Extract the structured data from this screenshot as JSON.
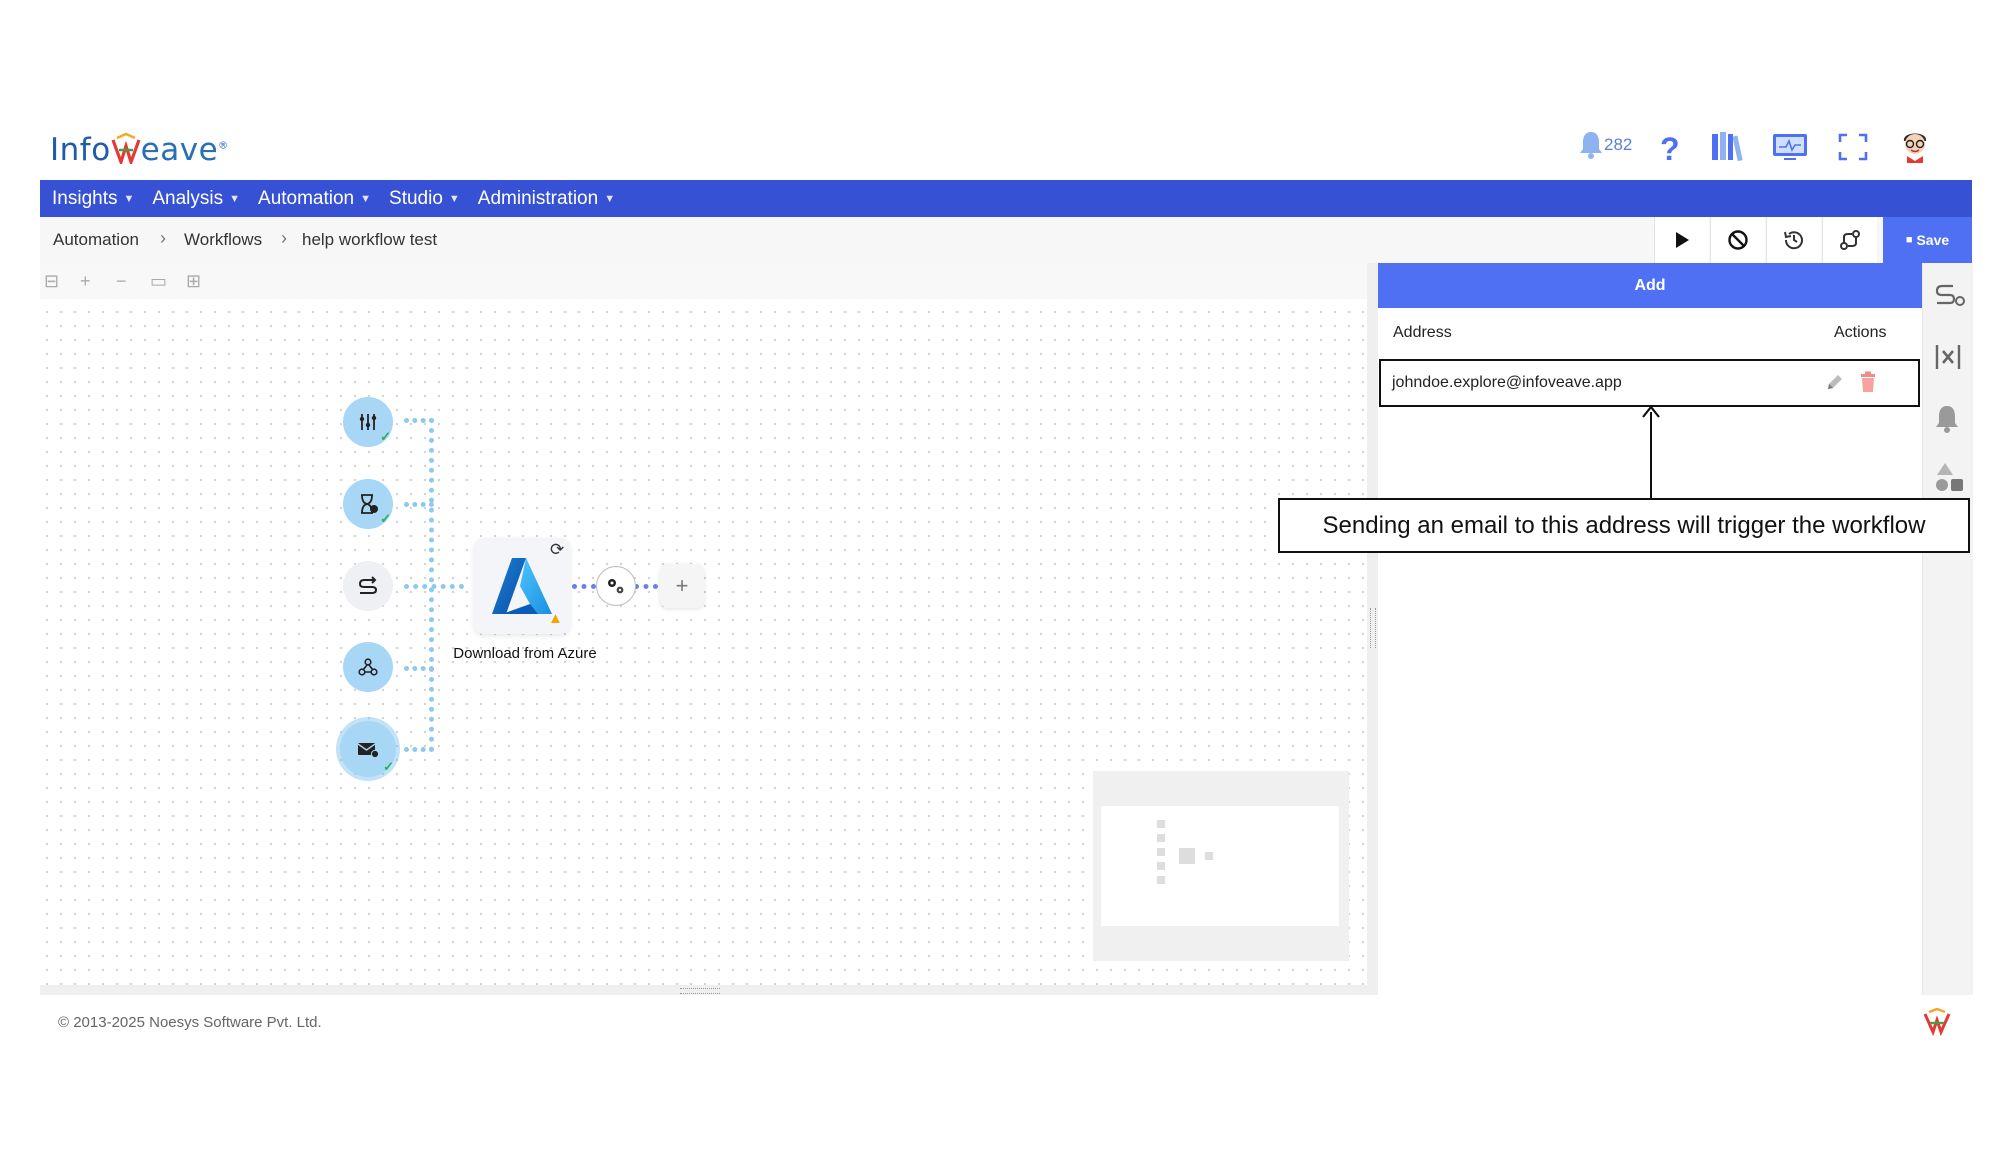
{
  "app": {
    "logo_text_a": "Info",
    "logo_text_b": "eave",
    "notification_count": "282"
  },
  "menu": [
    {
      "label": "Insights"
    },
    {
      "label": "Analysis"
    },
    {
      "label": "Automation"
    },
    {
      "label": "Studio"
    },
    {
      "label": "Administration"
    }
  ],
  "breadcrumb": {
    "items": [
      "Automation",
      "Workflows",
      "help workflow test"
    ]
  },
  "toolbar": {
    "save_label": "Save"
  },
  "workflow": {
    "node_label": "Download from Azure"
  },
  "panel": {
    "add_label": "Add",
    "col_address": "Address",
    "col_actions": "Actions",
    "rows": [
      {
        "address": "johndoe.explore@infoveave.app"
      }
    ]
  },
  "annotation": {
    "callout": "Sending an email to this address will trigger the workflow"
  },
  "footer": {
    "copyright": "© 2013-2025 Noesys Software Pvt. Ltd."
  },
  "colors": {
    "menubar": "#3651d4",
    "accent": "#4f70f2",
    "node": "#a8d6f5"
  }
}
